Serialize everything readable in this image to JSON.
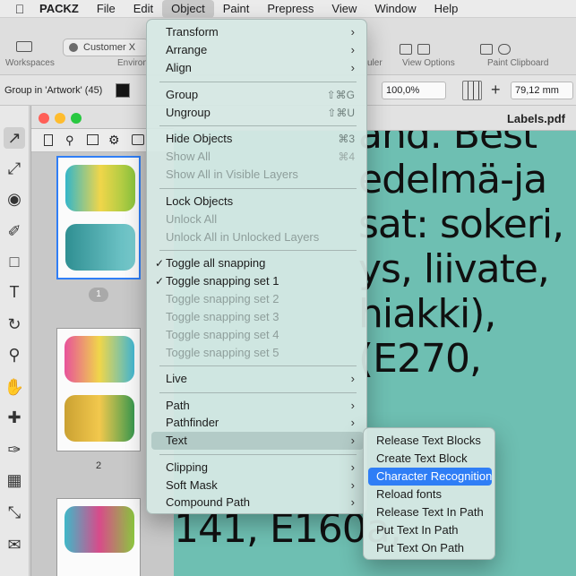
{
  "menubar": {
    "apple": "",
    "app": "PACKZ",
    "items": [
      "File",
      "Edit",
      "Object",
      "Paint",
      "Prepress",
      "View",
      "Window",
      "Help"
    ],
    "active": "Object"
  },
  "toolbar": {
    "workspaces_label": "Workspaces",
    "customer_button": "Customer X",
    "environ_label": "Environ",
    "ruler_label": "uler",
    "view_options_label": "View Options",
    "paint_clipboard_label": "Paint Clipboard"
  },
  "properties": {
    "selection_label": "Group in 'Artwork' (45)",
    "scale_value": "100,0%",
    "width_value": "79,12 mm"
  },
  "pages_panel": {
    "page1_badge": "1",
    "page2_label": "2"
  },
  "document": {
    "title": "Labels.pdf",
    "lines": [
      "and. Best",
      "edelmä-ja",
      "sat: sokeri,",
      "ys, liivate,",
      "hiakki),",
      "(E270,",
      "",
      "141, E160a,"
    ]
  },
  "menu": {
    "items": [
      {
        "label": "Transform",
        "submenu": true,
        "enabled": true
      },
      {
        "label": "Arrange",
        "submenu": true,
        "enabled": true
      },
      {
        "label": "Align",
        "submenu": true,
        "enabled": true
      },
      {
        "label": "Group",
        "shortcut": "⇧⌘G",
        "enabled": true
      },
      {
        "label": "Ungroup",
        "shortcut": "⇧⌘U",
        "enabled": true
      },
      {
        "label": "Hide Objects",
        "shortcut": "⌘3",
        "enabled": true
      },
      {
        "label": "Show All",
        "shortcut": "⌘4",
        "enabled": false
      },
      {
        "label": "Show All in Visible Layers",
        "enabled": false
      },
      {
        "label": "Lock Objects",
        "enabled": true
      },
      {
        "label": "Unlock All",
        "enabled": false
      },
      {
        "label": "Unlock All in Unlocked Layers",
        "enabled": false
      },
      {
        "label": "Toggle all snapping",
        "checked": true,
        "enabled": true
      },
      {
        "label": "Toggle snapping set 1",
        "checked": true,
        "enabled": true
      },
      {
        "label": "Toggle snapping set 2",
        "enabled": false
      },
      {
        "label": "Toggle snapping set 3",
        "enabled": false
      },
      {
        "label": "Toggle snapping set 4",
        "enabled": false
      },
      {
        "label": "Toggle snapping set 5",
        "enabled": false
      },
      {
        "label": "Live",
        "submenu": true,
        "enabled": true
      },
      {
        "label": "Path",
        "submenu": true,
        "enabled": true
      },
      {
        "label": "Pathfinder",
        "submenu": true,
        "enabled": true
      },
      {
        "label": "Text",
        "submenu": true,
        "enabled": true,
        "highlighted": true
      },
      {
        "label": "Clipping",
        "submenu": true,
        "enabled": true
      },
      {
        "label": "Soft Mask",
        "submenu": true,
        "enabled": true
      },
      {
        "label": "Compound Path",
        "submenu": true,
        "enabled": true
      }
    ]
  },
  "text_submenu": {
    "items": [
      "Release Text Blocks",
      "Create Text Block",
      "Character Recognition",
      "Reload fonts",
      "Release Text In Path",
      "Put Text In Path",
      "Put Text On Path"
    ],
    "selected": "Character Recognition"
  },
  "colors": {
    "accent": "#2f7ef6",
    "canvas_teal": "#6ebfb2",
    "menu_bg": "#d6e8e4"
  }
}
